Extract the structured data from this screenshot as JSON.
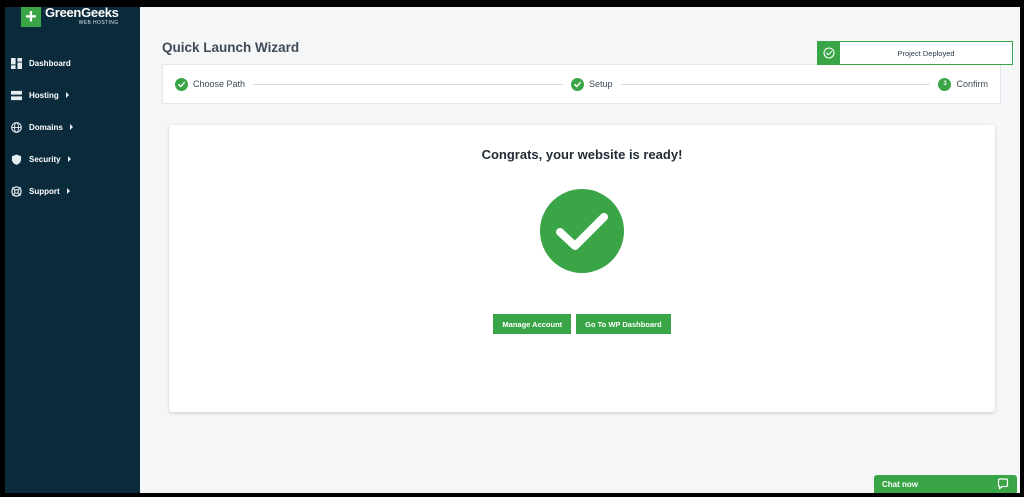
{
  "brand": {
    "name": "GreenGeeks",
    "tagline": "WEB HOSTING",
    "plus": "+",
    "accent": "#3aa547",
    "sidebar_bg": "#0b2a3c"
  },
  "sidebar": {
    "items": [
      {
        "label": "Dashboard",
        "icon": "dashboard-icon",
        "has_submenu": false
      },
      {
        "label": "Hosting",
        "icon": "server-icon",
        "has_submenu": true
      },
      {
        "label": "Domains",
        "icon": "globe-icon",
        "has_submenu": true
      },
      {
        "label": "Security",
        "icon": "shield-icon",
        "has_submenu": true
      },
      {
        "label": "Support",
        "icon": "lifebuoy-icon",
        "has_submenu": true
      }
    ]
  },
  "page": {
    "title": "Quick Launch Wizard"
  },
  "stepper": {
    "steps": [
      {
        "label": "Choose Path",
        "state": "complete"
      },
      {
        "label": "Setup",
        "state": "complete"
      },
      {
        "label": "Confirm",
        "state": "current",
        "number": "3"
      }
    ]
  },
  "card": {
    "title": "Congrats, your website is ready!",
    "icon": "check-circle-icon",
    "buttons": {
      "manage": "Manage Account",
      "wp": "Go To WP Dashboard"
    }
  },
  "toast": {
    "message": "Project Deployed",
    "icon": "check-circle-icon"
  },
  "chat": {
    "label": "Chat now",
    "icon": "chat-bubble-icon"
  }
}
